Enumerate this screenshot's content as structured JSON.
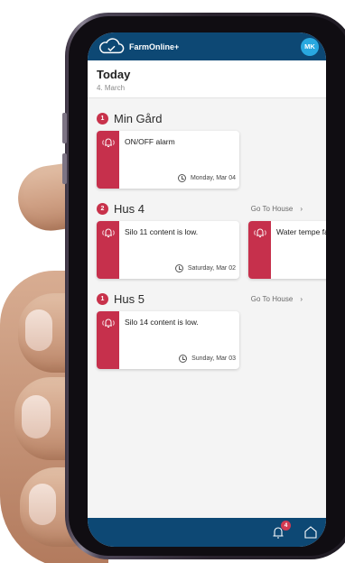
{
  "app": {
    "title": "FarmOnline+",
    "avatar_initials": "MK",
    "brand_color": "#0d4874",
    "alarm_color": "#c6304c"
  },
  "today": {
    "title": "Today",
    "date": "4. March"
  },
  "sections": [
    {
      "count": "1",
      "name": "Min Gård",
      "goto_label": "",
      "alarms": [
        {
          "text": "ON/OFF alarm",
          "time": "Monday, Mar 04",
          "icon": "alarm-bell-icon"
        }
      ]
    },
    {
      "count": "2",
      "name": "Hus 4",
      "goto_label": "Go To House",
      "alarms": [
        {
          "text": "Silo 11 content is low.",
          "time": "Saturday, Mar 02",
          "icon": "alarm-bell-icon"
        },
        {
          "text": "Water tempe failure",
          "time": "",
          "icon": "alarm-bell-icon"
        }
      ]
    },
    {
      "count": "1",
      "name": "Hus 5",
      "goto_label": "Go To House",
      "alarms": [
        {
          "text": "Silo 14 content is low.",
          "time": "Sunday, Mar 03",
          "icon": "alarm-bell-icon"
        }
      ]
    }
  ],
  "bottom_bar": {
    "notification_count": "4"
  }
}
